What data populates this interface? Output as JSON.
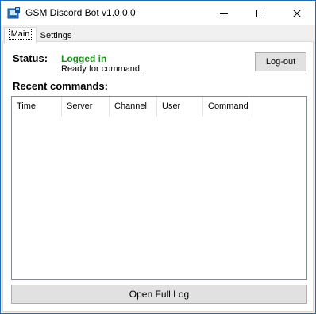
{
  "window": {
    "title": "GSM Discord Bot v1.0.0.0",
    "border_color": "#1e6bb8"
  },
  "title_controls": {
    "minimize_icon": "minimize-icon",
    "maximize_icon": "maximize-icon",
    "close_icon": "close-icon"
  },
  "tabs": [
    {
      "label": "Main",
      "selected": true
    },
    {
      "label": "Settings",
      "selected": false
    }
  ],
  "status": {
    "label": "Status:",
    "value": "Logged in",
    "value_color": "#1e8a1e",
    "detail": "Ready for command."
  },
  "logout_button": {
    "label": "Log-out"
  },
  "recent": {
    "label": "Recent commands:",
    "columns": [
      "Time",
      "Server",
      "Channel",
      "User",
      "Command"
    ],
    "rows": []
  },
  "open_log_button": {
    "label": "Open Full Log"
  }
}
